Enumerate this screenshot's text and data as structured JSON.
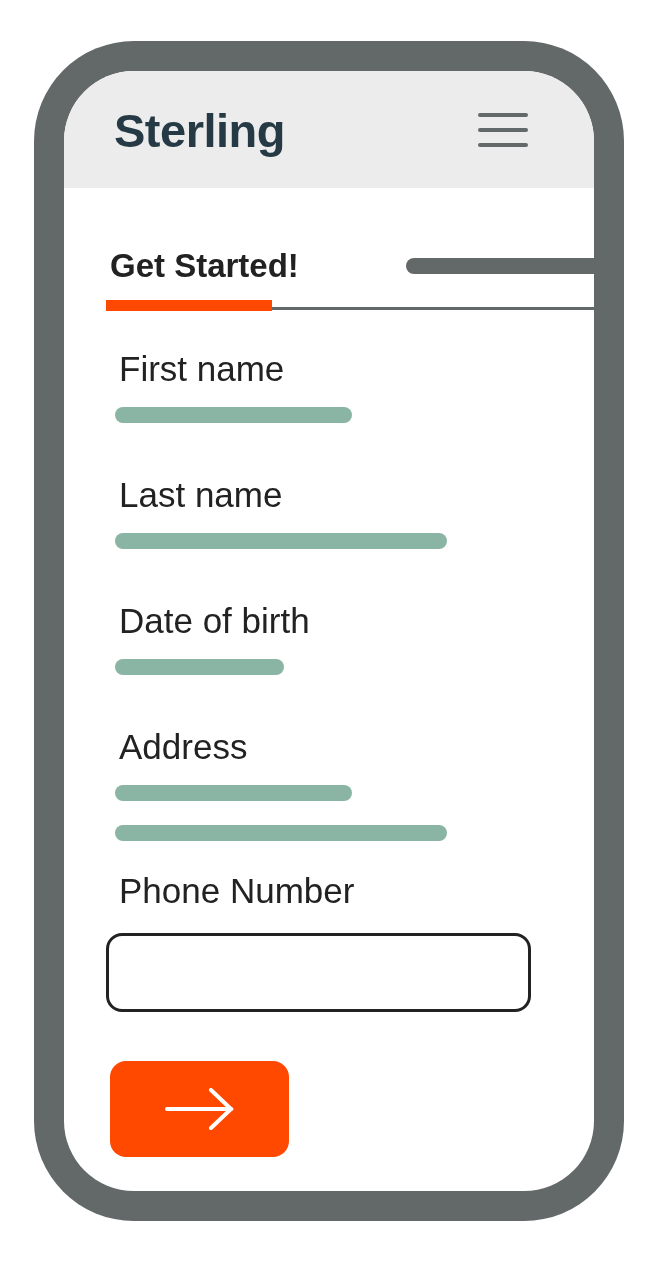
{
  "header": {
    "logo": "Sterling"
  },
  "step": {
    "title": "Get Started!"
  },
  "progress": {
    "level": 0.34
  },
  "form": {
    "fields": [
      {
        "label": "First name",
        "kind": "filled",
        "lines": [
          {
            "kind": "medium"
          }
        ]
      },
      {
        "label": "Last name",
        "kind": "filled",
        "lines": [
          {
            "kind": "long"
          }
        ]
      },
      {
        "label": "Date of birth",
        "kind": "filled",
        "lines": [
          {
            "kind": "short"
          }
        ]
      },
      {
        "label": "Address",
        "kind": "filled",
        "lines": [
          {
            "kind": "medium"
          },
          {
            "kind": "long"
          }
        ]
      },
      {
        "label": "Phone Number",
        "kind": "input"
      }
    ]
  }
}
